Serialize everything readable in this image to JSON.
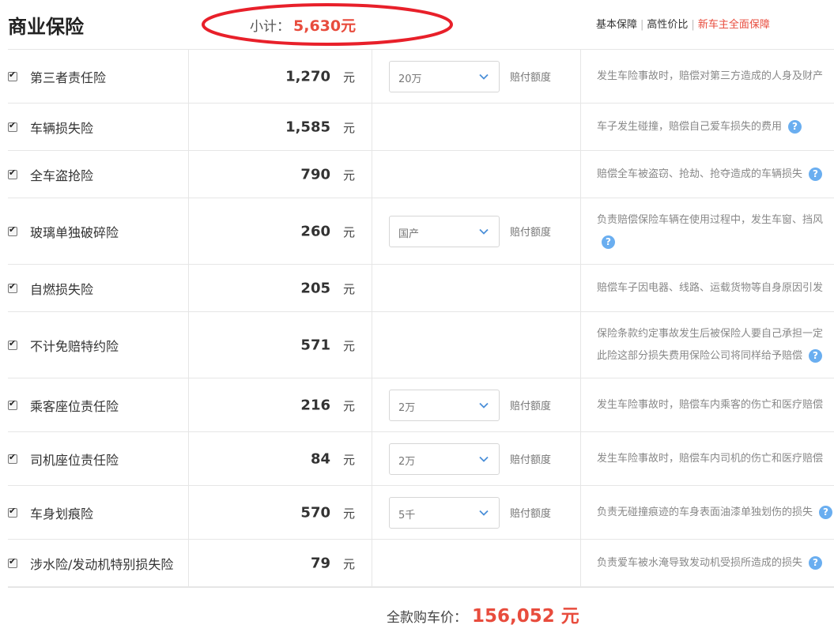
{
  "header": {
    "title": "商业保险",
    "subtotal_label": "小计：",
    "subtotal_value": "5,630元",
    "plans": [
      "基本保障",
      "高性价比",
      "新车主全面保障"
    ]
  },
  "rows": [
    {
      "name": "第三者责任险",
      "amount": "1,270",
      "unit": "元",
      "option": "20万",
      "option_label": "赔付额度",
      "desc": [
        "发生车险事故时，赔偿对第三方造成的人身及财产"
      ],
      "help": false
    },
    {
      "name": "车辆损失险",
      "amount": "1,585",
      "unit": "元",
      "desc": [
        "车子发生碰撞，赔偿自己爱车损失的费用"
      ],
      "help": true
    },
    {
      "name": "全车盗抢险",
      "amount": "790",
      "unit": "元",
      "desc": [
        "赔偿全车被盗窃、抢劫、抢夺造成的车辆损失"
      ],
      "help": true
    },
    {
      "name": "玻璃单独破碎险",
      "amount": "260",
      "unit": "元",
      "option": "国产",
      "option_label": "赔付额度",
      "desc": [
        "负责赔偿保险车辆在使用过程中，发生车窗、挡风"
      ],
      "help": true
    },
    {
      "name": "自燃损失险",
      "amount": "205",
      "unit": "元",
      "desc": [
        "赔偿车子因电器、线路、运载货物等自身原因引发"
      ],
      "help": false
    },
    {
      "name": "不计免赔特约险",
      "amount": "571",
      "unit": "元",
      "desc": [
        "保险条款约定事故发生后被保险人要自己承担一定",
        "此险这部分损失费用保险公司将同样给予赔偿"
      ],
      "help": true
    },
    {
      "name": "乘客座位责任险",
      "amount": "216",
      "unit": "元",
      "option": "2万",
      "option_label": "赔付额度",
      "desc": [
        "发生车险事故时，赔偿车内乘客的伤亡和医疗赔偿"
      ],
      "help": false
    },
    {
      "name": "司机座位责任险",
      "amount": "84",
      "unit": "元",
      "option": "2万",
      "option_label": "赔付额度",
      "desc": [
        "发生车险事故时，赔偿车内司机的伤亡和医疗赔偿"
      ],
      "help": false
    },
    {
      "name": "车身划痕险",
      "amount": "570",
      "unit": "元",
      "option": "5千",
      "option_label": "赔付额度",
      "desc": [
        "负责无碰撞痕迹的车身表面油漆单独划伤的损失"
      ],
      "help": true
    },
    {
      "name": "涉水险/发动机特别损失险",
      "amount": "79",
      "unit": "元",
      "desc": [
        "负责爱车被水淹导致发动机受损所造成的损失"
      ],
      "help": true
    }
  ],
  "footer": {
    "total_label": "全款购车价：",
    "total_value": "156,052 元"
  },
  "colors": {
    "accent": "#e84c3d",
    "help": "#6aaef0"
  },
  "help_icon_glyph": "?"
}
